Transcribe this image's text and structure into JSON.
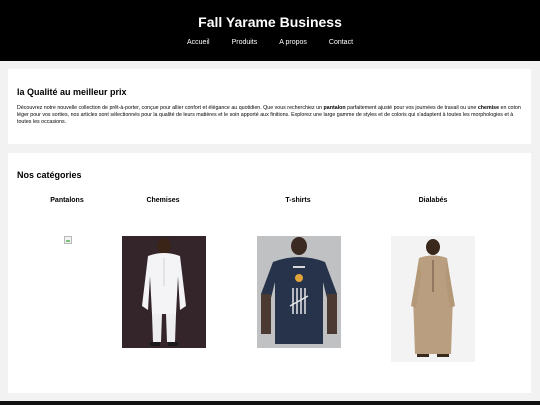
{
  "site": {
    "title": "Fall Yarame Business",
    "nav": [
      "Accueil",
      "Produits",
      "A propos",
      "Contact"
    ]
  },
  "intro": {
    "heading": "la Qualité au meilleur prix",
    "text_1": "Découvrez notre nouvelle collection de prêt-à-porter, conçue pour allier confort et élégance au quotidien. Que vous recherchiez un ",
    "bold_1": "pantalon",
    "text_2": " parfaitement ajusté pour vos journées de travail ou une ",
    "bold_2": "chemise",
    "text_3": " en coton léger pour vos sorties, nos articles sont sélectionnés pour la qualité de leurs matières et le soin apporté aux finitions. Explorez une large gamme de styles et de coloris qui s'adaptent à toutes les morphologies et à toutes les occasions."
  },
  "categories": {
    "heading": "Nos catégories",
    "items": [
      {
        "label": "Pantalons",
        "image": "broken-image-icon"
      },
      {
        "label": "Chemises",
        "image": "white-kaftan-photo"
      },
      {
        "label": "T-shirts",
        "image": "navy-tshirt-photo"
      },
      {
        "label": "Dialabés",
        "image": "beige-dialabe-photo"
      }
    ]
  },
  "colors": {
    "header_bg": "#000000",
    "page_bg": "#f2f2f2",
    "card_bg": "#ffffff"
  }
}
